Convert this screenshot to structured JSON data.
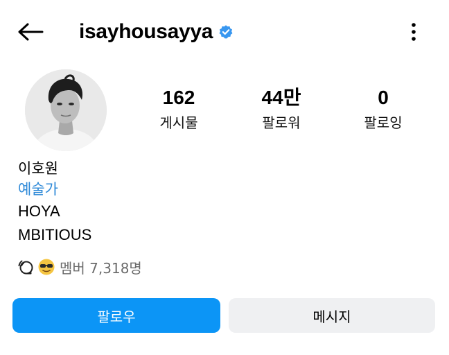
{
  "header": {
    "username": "isayhousayya",
    "back_icon": "arrow-left-icon",
    "verified_icon": "verified-badge-icon",
    "more_icon": "more-vertical-icon",
    "verified_color": "#3897f0"
  },
  "profile": {
    "avatar_icon": "profile-photo"
  },
  "stats": [
    {
      "value": "162",
      "label": "게시물"
    },
    {
      "value": "44만",
      "label": "팔로워"
    },
    {
      "value": "0",
      "label": "팔로잉"
    }
  ],
  "bio": {
    "name": "이호원",
    "category": "예술가",
    "line1": "HOYA",
    "line2": "MBITIOUS",
    "category_color": "#2f8ad8"
  },
  "channel": {
    "icon": "broadcast-channel-icon",
    "emoji": "sunglasses-emoji",
    "members_text": "멤버 7,318명"
  },
  "actions": {
    "follow_label": "팔로우",
    "message_label": "메시지",
    "follow_color": "#0c95f6",
    "message_color": "#eff0f2"
  }
}
